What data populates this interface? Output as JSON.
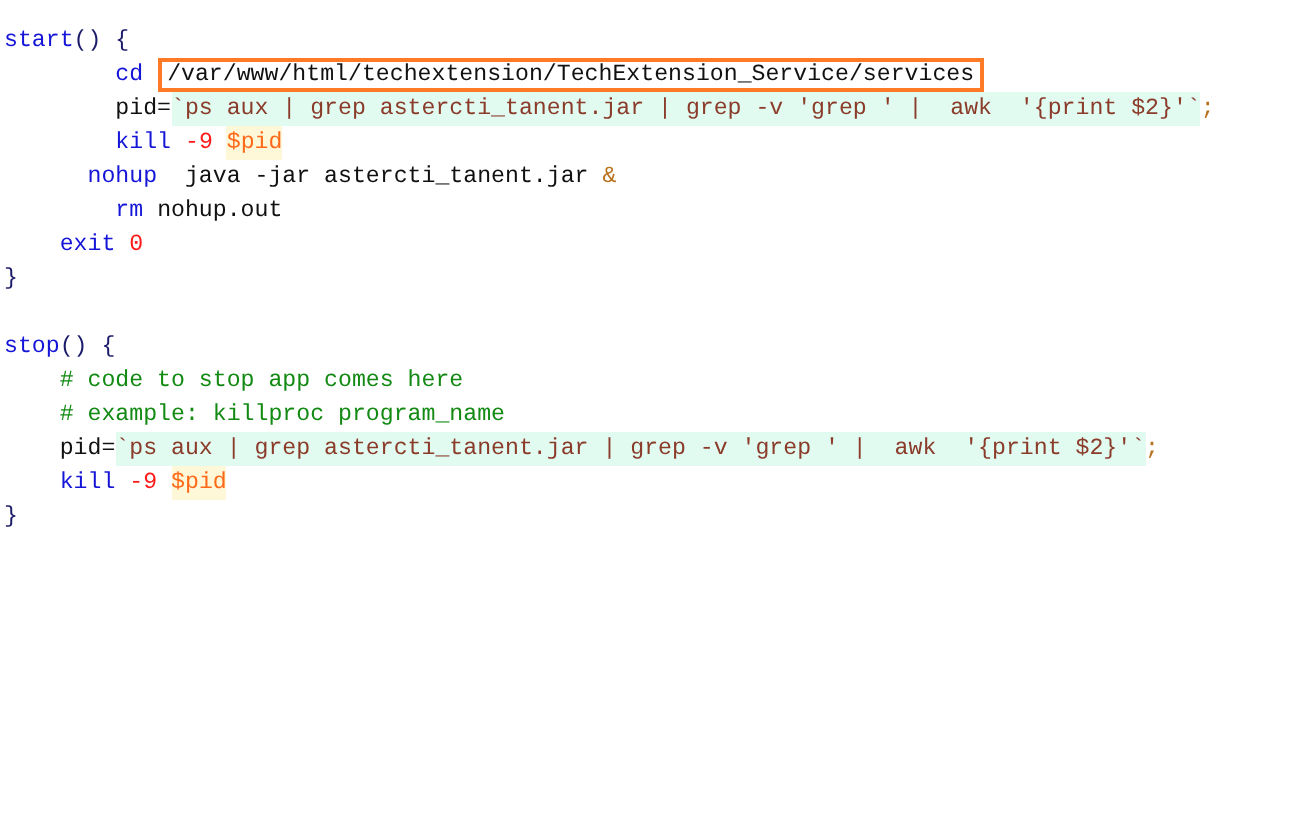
{
  "functions": [
    {
      "lines": [
        {
          "tokens": [
            {
              "text": "start",
              "kind": "keyword"
            },
            {
              "text": "() {",
              "kind": "punct"
            }
          ]
        },
        {
          "tokens": [
            {
              "text": "        cd",
              "kind": "keyword"
            },
            {
              "text": " /var/www/html/techextension/TechExtension_Service/services",
              "kind": "boxed"
            }
          ]
        },
        {
          "tokens": [
            {
              "text": "        pid=",
              "kind": "plain"
            },
            {
              "text": "`ps aux | grep astercti_tanent.jar | grep -v 'grep ' |  awk  '{print $2}'`",
              "kind": "string"
            },
            {
              "text": ";",
              "kind": "operator"
            }
          ]
        },
        {
          "tokens": [
            {
              "text": "        kill",
              "kind": "keyword"
            },
            {
              "text": " -9",
              "kind": "number"
            },
            {
              "text": " $pid",
              "kind": "variable"
            }
          ]
        },
        {
          "tokens": [
            {
              "text": "      nohup",
              "kind": "keyword"
            },
            {
              "text": "  java -jar astercti_tanent.jar",
              "kind": "plain"
            },
            {
              "text": " &",
              "kind": "operator"
            }
          ]
        },
        {
          "tokens": [
            {
              "text": "        rm",
              "kind": "keyword"
            },
            {
              "text": " nohup.out",
              "kind": "plain"
            }
          ]
        },
        {
          "tokens": [
            {
              "text": "    exit",
              "kind": "keyword"
            },
            {
              "text": " 0",
              "kind": "number"
            }
          ]
        },
        {
          "tokens": [
            {
              "text": "}",
              "kind": "punct"
            }
          ]
        }
      ]
    },
    {
      "lines": [
        {
          "tokens": [
            {
              "text": "stop",
              "kind": "keyword"
            },
            {
              "text": "() {",
              "kind": "punct"
            }
          ]
        },
        {
          "tokens": [
            {
              "text": "    # code to stop app comes here",
              "kind": "comment"
            }
          ]
        },
        {
          "tokens": [
            {
              "text": "    # example: killproc program_name",
              "kind": "comment"
            }
          ]
        },
        {
          "tokens": [
            {
              "text": "    pid=",
              "kind": "plain"
            },
            {
              "text": "`ps aux | grep astercti_tanent.jar | grep -v 'grep ' |  awk  '{print $2}'`",
              "kind": "string"
            },
            {
              "text": ";",
              "kind": "operator"
            }
          ]
        },
        {
          "tokens": [
            {
              "text": "    kill",
              "kind": "keyword"
            },
            {
              "text": " -9",
              "kind": "number"
            },
            {
              "text": " $pid",
              "kind": "variable"
            }
          ]
        },
        {
          "tokens": [
            {
              "text": "}",
              "kind": "punct"
            }
          ]
        }
      ]
    }
  ]
}
